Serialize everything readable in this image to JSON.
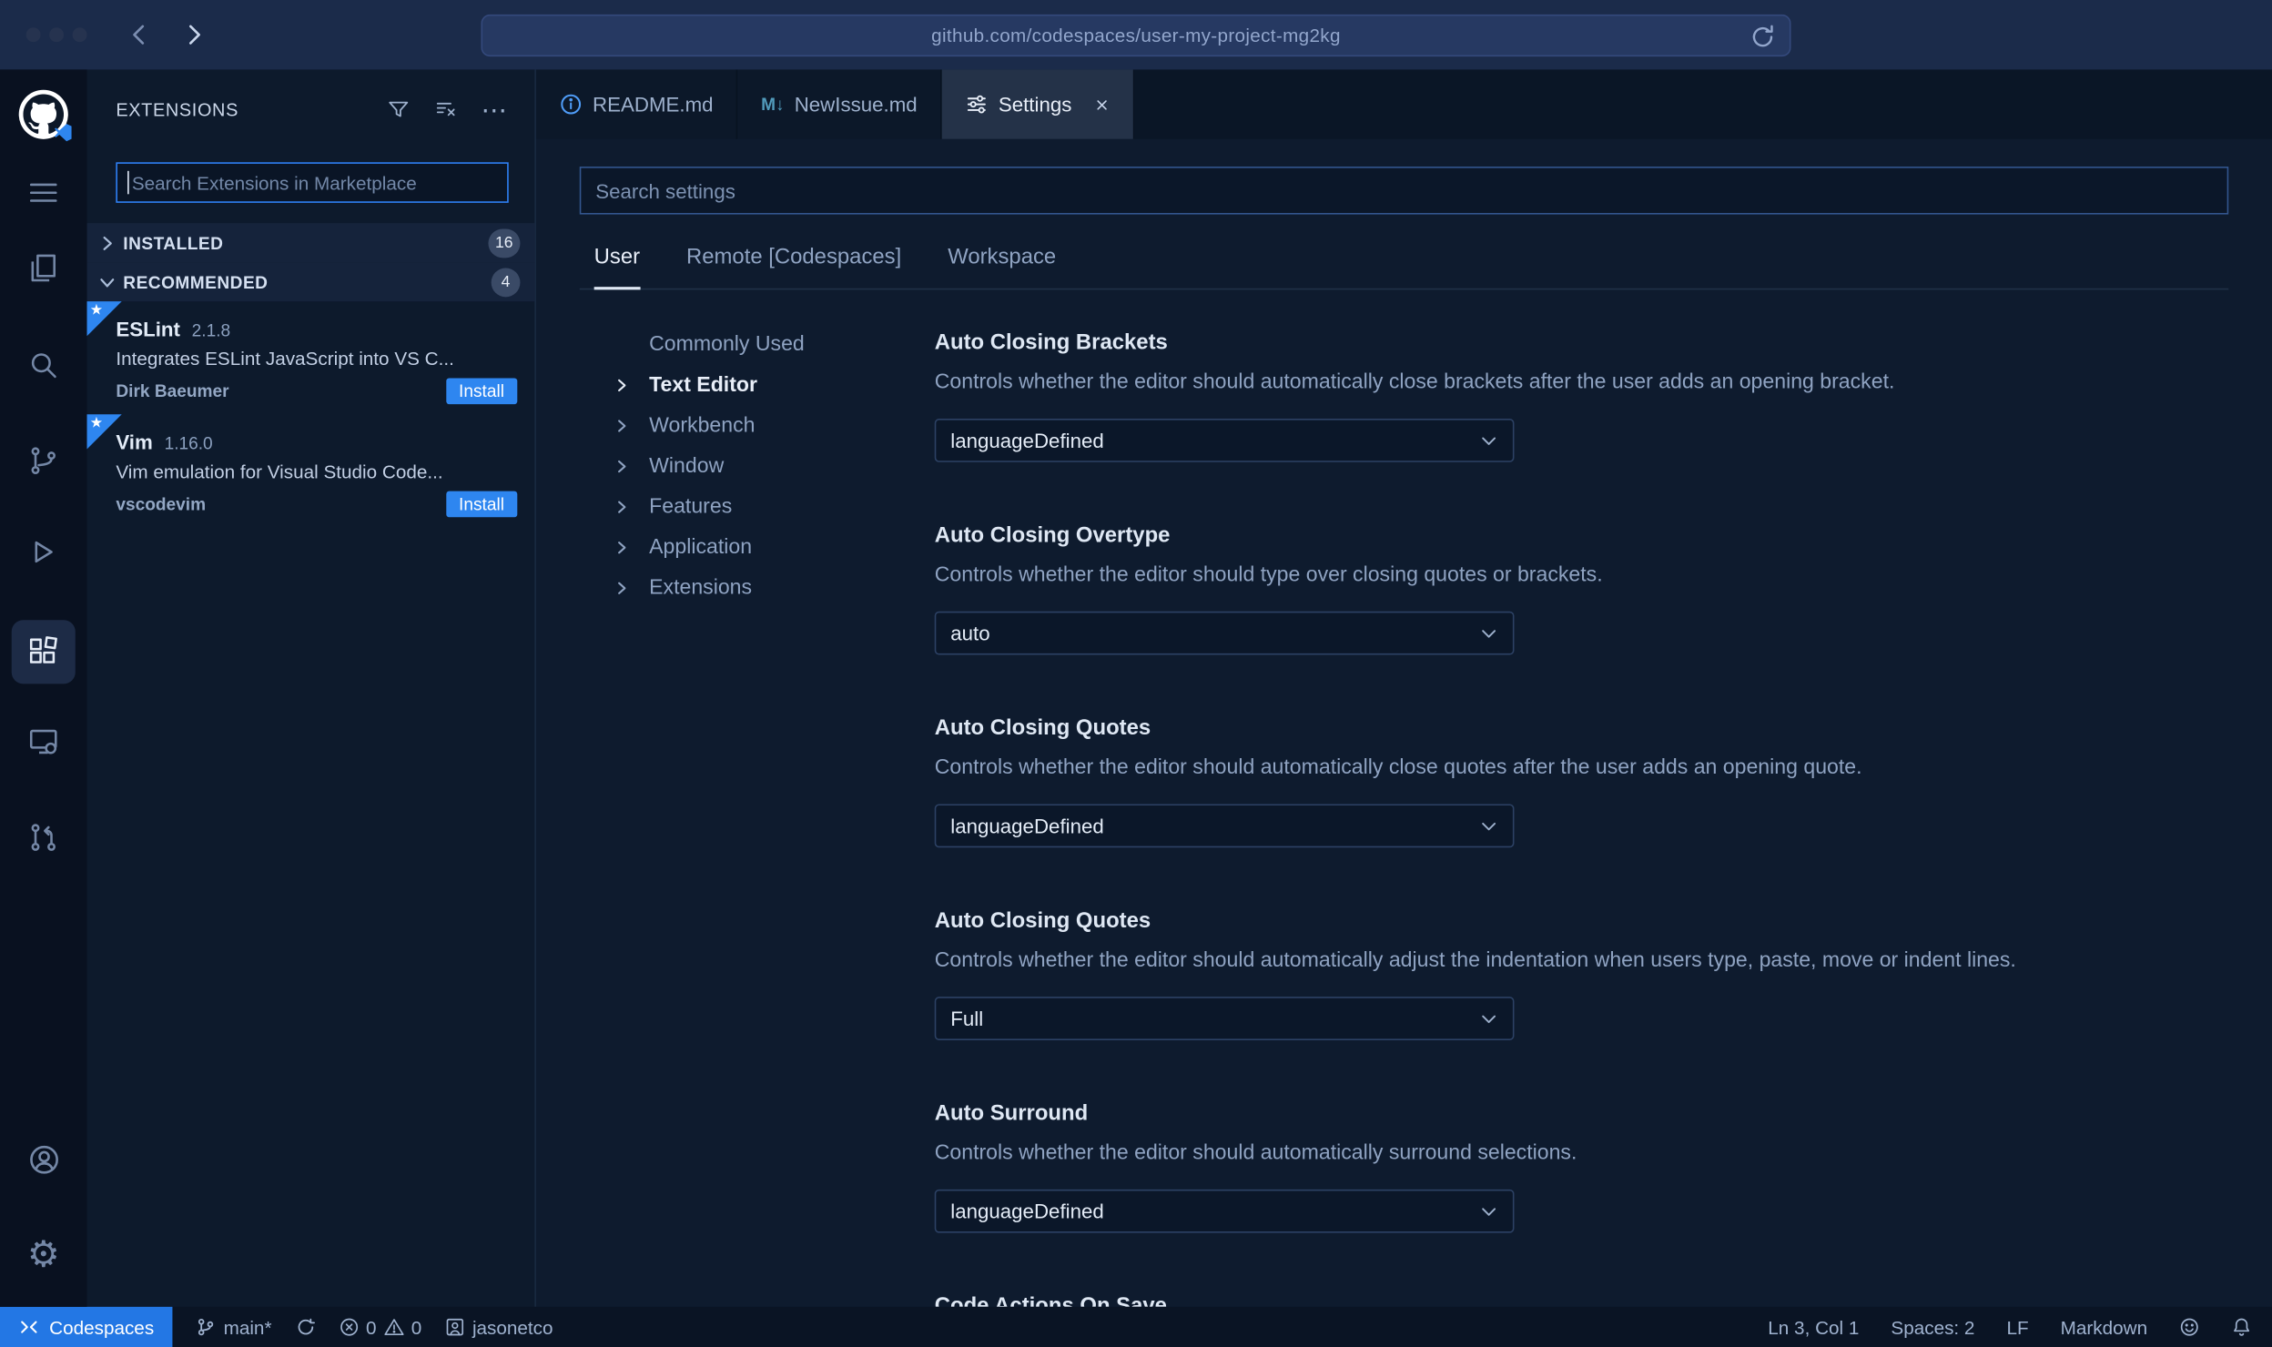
{
  "browser": {
    "url": "github.com/codespaces/user-my-project-mg2kg"
  },
  "icons": {
    "more": "⋯",
    "gear": "⚙",
    "flag_star": "★",
    "newissue_glyph": "M↓"
  },
  "colors": {
    "accent_blue": "#2f81f7",
    "install_blue": "#2e86f0",
    "remote_blue": "#2377e4",
    "markdown_icon_blue": "#519aba"
  },
  "sidebar": {
    "title": "EXTENSIONS",
    "search_placeholder": "Search Extensions in Marketplace",
    "sections": {
      "installed": {
        "label": "INSTALLED",
        "count": "16"
      },
      "recommended": {
        "label": "RECOMMENDED",
        "count": "4"
      }
    },
    "extensions": [
      {
        "name": "ESLint",
        "version": "2.1.8",
        "description": "Integrates ESLint JavaScript into VS C...",
        "author": "Dirk Baeumer",
        "action": "Install"
      },
      {
        "name": "Vim",
        "version": "1.16.0",
        "description": "Vim emulation for Visual Studio Code...",
        "author": "vscodevim",
        "action": "Install"
      }
    ]
  },
  "tabs": {
    "readme": "README.md",
    "newissue": "NewIssue.md",
    "settings": "Settings"
  },
  "settings_editor": {
    "search_placeholder": "Search settings",
    "scopes": {
      "user": "User",
      "remote": "Remote [Codespaces]",
      "workspace": "Workspace"
    },
    "toc": [
      "Commonly Used",
      "Text Editor",
      "Workbench",
      "Window",
      "Features",
      "Application",
      "Extensions"
    ],
    "entries": [
      {
        "title": "Auto Closing Brackets",
        "description": "Controls whether the editor should automatically close brackets after the user adds an opening bracket.",
        "value": "languageDefined"
      },
      {
        "title": "Auto Closing Overtype",
        "description": "Controls whether the editor should type over closing quotes or brackets.",
        "value": "auto"
      },
      {
        "title": "Auto Closing Quotes",
        "description": "Controls whether the editor should automatically close quotes after the user adds an opening quote.",
        "value": "languageDefined"
      },
      {
        "title": "Auto Closing Quotes",
        "description": "Controls whether the editor should automatically adjust the indentation when users type, paste, move or indent lines.",
        "value": "Full"
      },
      {
        "title": "Auto Surround",
        "description": "Controls whether the editor should automatically surround selections.",
        "value": "languageDefined"
      },
      {
        "title": "Code Actions On Save"
      }
    ]
  },
  "status_bar": {
    "remote": "Codespaces",
    "branch": "main*",
    "error_count": "0",
    "warning_count": "0",
    "user": "jasonetco",
    "line_col": "Ln 3, Col 1",
    "indent": "Spaces: 2",
    "eol": "LF",
    "language": "Markdown"
  }
}
